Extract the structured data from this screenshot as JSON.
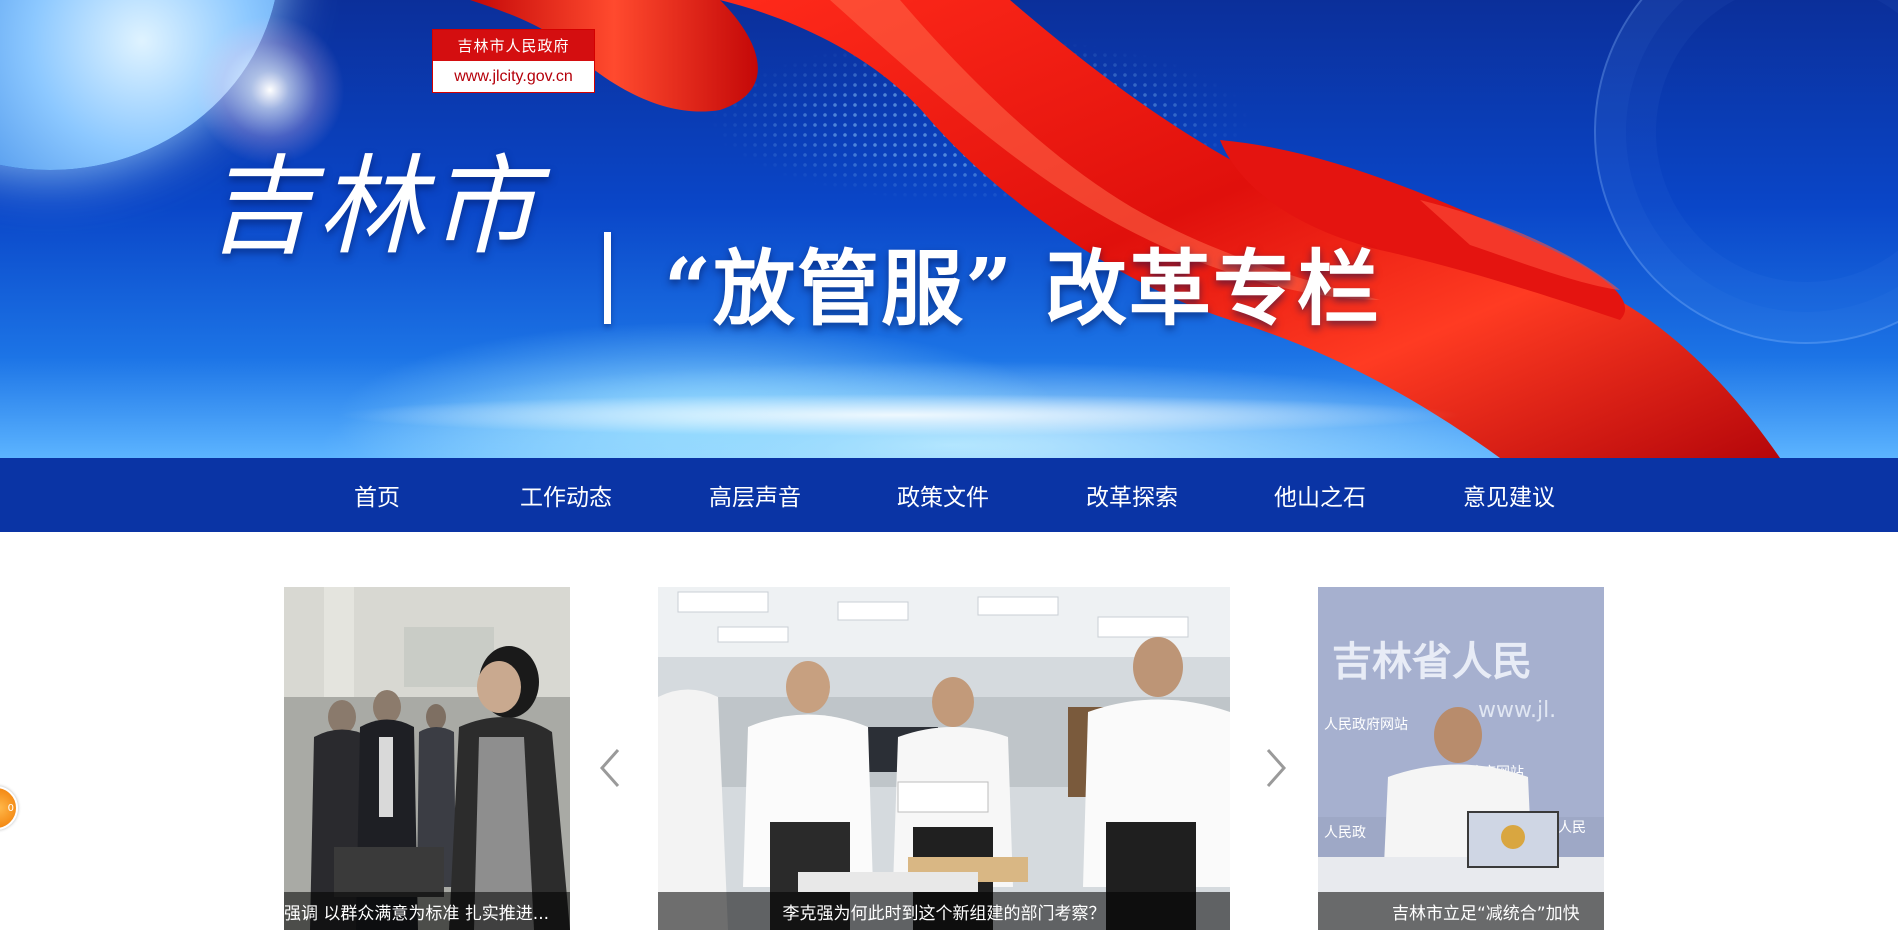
{
  "banner": {
    "logo_top": "吉林市人民政府",
    "logo_url": "www.jlcity.gov.cn",
    "title_city": "吉林市",
    "title_main": "“放管服” 改革专栏"
  },
  "nav": {
    "items": [
      {
        "label": "首页"
      },
      {
        "label": "工作动态"
      },
      {
        "label": "高层声音"
      },
      {
        "label": "政策文件"
      },
      {
        "label": "改革探索"
      },
      {
        "label": "他山之石"
      },
      {
        "label": "意见建议"
      }
    ]
  },
  "carousel": {
    "slides": [
      {
        "caption": "强调 以群众满意为标准 扎实推进..."
      },
      {
        "caption": "李克强为何此时到这个新组建的部门考察？"
      },
      {
        "caption": "吉林市立足“减统合”加快"
      }
    ],
    "photo_texts": {
      "sign_line1": "吉林省人民",
      "sign_line2": "www.jl.",
      "sign_small1": "人民政府网站",
      "sign_small2": "政府网站",
      "sign_small3": "人民政",
      "sign_small4": "省人民"
    },
    "prev_icon": "chevron-left-icon",
    "next_icon": "chevron-right-icon"
  },
  "float_badge": {
    "text": "0"
  },
  "colors": {
    "nav_bg": "#0a34a5",
    "banner_red": "#d40e10"
  }
}
